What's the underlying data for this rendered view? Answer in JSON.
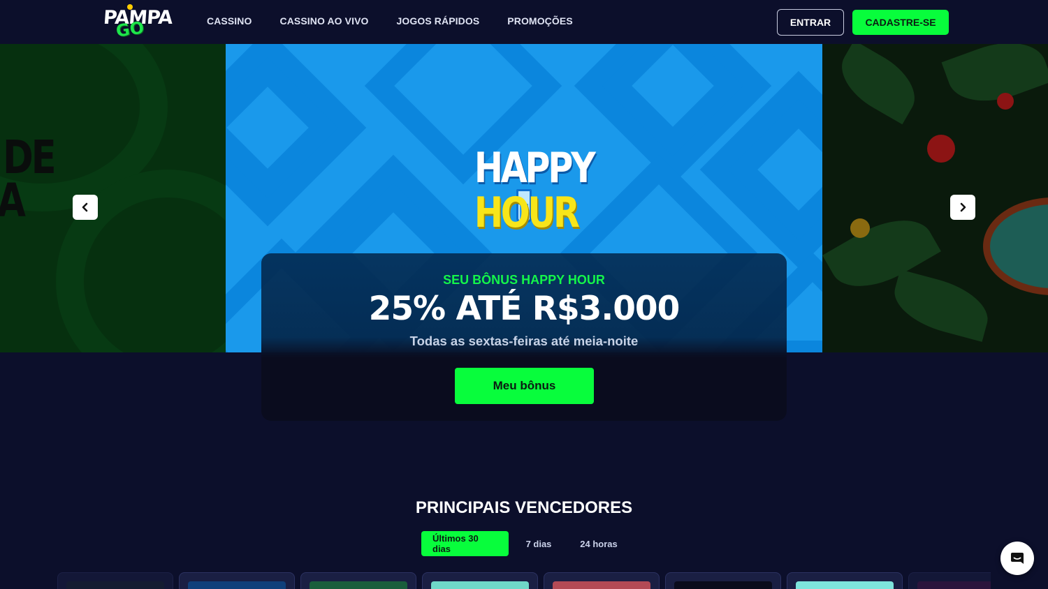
{
  "header": {
    "logo_top": "PAMPA",
    "logo_bottom": "GO",
    "nav": [
      {
        "label": "CASSINO"
      },
      {
        "label": "CASSINO AO VIVO"
      },
      {
        "label": "JOGOS RÁPIDOS"
      },
      {
        "label": "PROMOÇÕES"
      }
    ],
    "login_label": "ENTRAR",
    "signup_label": "CADASTRE-SE"
  },
  "banner": {
    "left_slide_text_line1": "DE",
    "left_slide_text_line2": "A",
    "happy_line1": "HAPPY",
    "happy_line2": "HOUR",
    "prev_icon": "chevron-left-icon",
    "next_icon": "chevron-right-icon"
  },
  "promo": {
    "subtitle": "SEU BÔNUS HAPPY HOUR",
    "title": "25% ATÉ R$3.000",
    "description": "Todas as sextas-feiras até meia-noite",
    "button_label": "Meu bônus"
  },
  "winners": {
    "title": "PRINCIPAIS VENCEDORES",
    "tabs": [
      {
        "label": "Últimos 30 dias",
        "active": true
      },
      {
        "label": "7 dias",
        "active": false
      },
      {
        "label": "24 horas",
        "active": false
      }
    ]
  },
  "chat": {
    "icon": "chat-icon"
  },
  "colors": {
    "background": "#0c0f2b",
    "accent_green": "#08fd3c",
    "banner_blue": "#1a99eb",
    "happy_yellow": "#f8e51a"
  }
}
